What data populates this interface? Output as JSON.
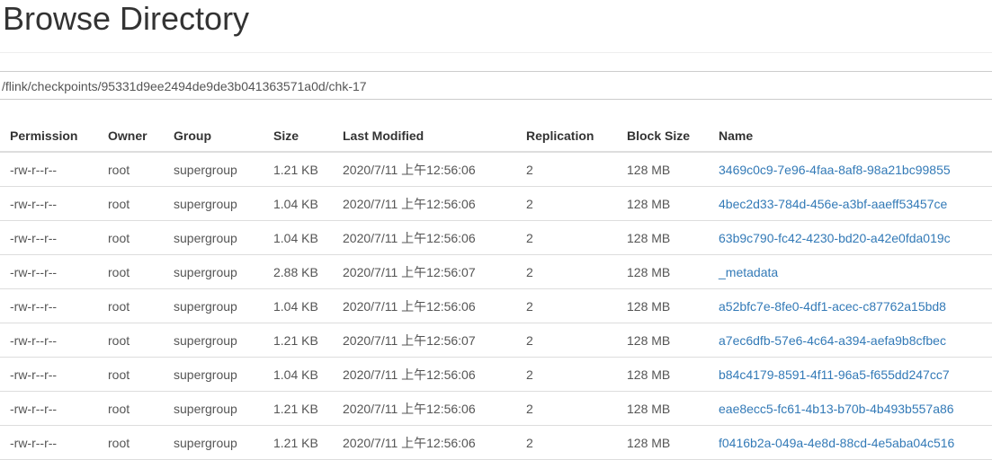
{
  "page": {
    "title": "Browse Directory",
    "path": "/flink/checkpoints/95331d9ee2494de9de3b041363571a0d/chk-17"
  },
  "table": {
    "columns": [
      "Permission",
      "Owner",
      "Group",
      "Size",
      "Last Modified",
      "Replication",
      "Block Size",
      "Name"
    ],
    "rows": [
      {
        "permission": "-rw-r--r--",
        "owner": "root",
        "group": "supergroup",
        "size": "1.21 KB",
        "modified": "2020/7/11 上午12:56:06",
        "replication": "2",
        "block_size": "128 MB",
        "name": "3469c0c9-7e96-4faa-8af8-98a21bc99855"
      },
      {
        "permission": "-rw-r--r--",
        "owner": "root",
        "group": "supergroup",
        "size": "1.04 KB",
        "modified": "2020/7/11 上午12:56:06",
        "replication": "2",
        "block_size": "128 MB",
        "name": "4bec2d33-784d-456e-a3bf-aaeff53457ce"
      },
      {
        "permission": "-rw-r--r--",
        "owner": "root",
        "group": "supergroup",
        "size": "1.04 KB",
        "modified": "2020/7/11 上午12:56:06",
        "replication": "2",
        "block_size": "128 MB",
        "name": "63b9c790-fc42-4230-bd20-a42e0fda019c"
      },
      {
        "permission": "-rw-r--r--",
        "owner": "root",
        "group": "supergroup",
        "size": "2.88 KB",
        "modified": "2020/7/11 上午12:56:07",
        "replication": "2",
        "block_size": "128 MB",
        "name": "_metadata"
      },
      {
        "permission": "-rw-r--r--",
        "owner": "root",
        "group": "supergroup",
        "size": "1.04 KB",
        "modified": "2020/7/11 上午12:56:06",
        "replication": "2",
        "block_size": "128 MB",
        "name": "a52bfc7e-8fe0-4df1-acec-c87762a15bd8"
      },
      {
        "permission": "-rw-r--r--",
        "owner": "root",
        "group": "supergroup",
        "size": "1.21 KB",
        "modified": "2020/7/11 上午12:56:07",
        "replication": "2",
        "block_size": "128 MB",
        "name": "a7ec6dfb-57e6-4c64-a394-aefa9b8cfbec"
      },
      {
        "permission": "-rw-r--r--",
        "owner": "root",
        "group": "supergroup",
        "size": "1.04 KB",
        "modified": "2020/7/11 上午12:56:06",
        "replication": "2",
        "block_size": "128 MB",
        "name": "b84c4179-8591-4f11-96a5-f655dd247cc7"
      },
      {
        "permission": "-rw-r--r--",
        "owner": "root",
        "group": "supergroup",
        "size": "1.21 KB",
        "modified": "2020/7/11 上午12:56:06",
        "replication": "2",
        "block_size": "128 MB",
        "name": "eae8ecc5-fc61-4b13-b70b-4b493b557a86"
      },
      {
        "permission": "-rw-r--r--",
        "owner": "root",
        "group": "supergroup",
        "size": "1.21 KB",
        "modified": "2020/7/11 上午12:56:06",
        "replication": "2",
        "block_size": "128 MB",
        "name": "f0416b2a-049a-4e8d-88cd-4e5aba04c516"
      }
    ]
  },
  "colors": {
    "link": "#337ab7",
    "text": "#333333",
    "border": "#dddddd"
  }
}
